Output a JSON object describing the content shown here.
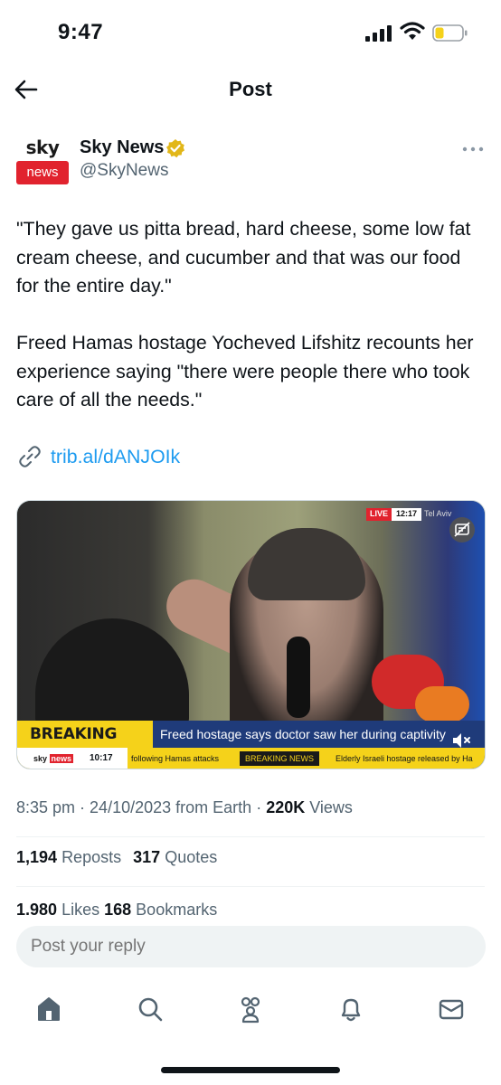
{
  "status_bar": {
    "time": "9:47",
    "icons": [
      "cellular-signal-icon",
      "wifi-icon",
      "battery-low-icon"
    ],
    "battery_color": "#f5d21a"
  },
  "header": {
    "title": "Post",
    "back_icon": "back-arrow-icon"
  },
  "author": {
    "name": "Sky News",
    "handle": "@SkyNews",
    "verified": true,
    "verified_color": "#e2b719",
    "avatar": {
      "top_text": "sky",
      "bottom_text": "news",
      "brand_color": "#e1232e"
    },
    "more_icon": "more-dots-icon"
  },
  "post": {
    "paragraph_1": "\"They gave us pitta bread, hard cheese, some low fat cream cheese, and cucumber and that was our food for the entire day.\"",
    "paragraph_2": "Freed Hamas hostage Yocheved Lifshitz recounts her experience saying \"there were people there who took care of all the needs.\"",
    "link_icon": "link-icon",
    "link_text": "trib.al/dANJOIk",
    "link_color": "#1d9bf0"
  },
  "video": {
    "live_label": "LIVE",
    "live_time": "12:17",
    "city": "Tel Aviv",
    "breaking_label": "BREAKING NEWS",
    "headline": "Freed hostage says doctor saw her during captivity",
    "ticker_brand_1": "sky",
    "ticker_brand_2": "news",
    "ticker_time": "10:17",
    "ticker_1": "following Hamas attacks",
    "ticker_2": "BREAKING NEWS",
    "ticker_3": "Elderly Israeli hostage released by Ha",
    "mute_icon": "muted-speaker-icon",
    "caption_icon": "captions-icon"
  },
  "meta": {
    "time": "8:35 pm",
    "date": "24/10/2023",
    "source": "from Earth",
    "views_count": "220K",
    "views_label": "Views",
    "sep": " · "
  },
  "stats": {
    "reposts_count": "1,194",
    "reposts_label": "Reposts",
    "quotes_count": "317",
    "quotes_label": "Quotes",
    "likes_count": "1,980",
    "likes_label": "Likes",
    "bookmarks_count": "168",
    "bookmarks_label": "Bookmarks"
  },
  "reply": {
    "placeholder": "Post your reply"
  },
  "nav": {
    "items": [
      "home-icon",
      "search-icon",
      "communities-icon",
      "notifications-icon",
      "messages-icon"
    ]
  }
}
